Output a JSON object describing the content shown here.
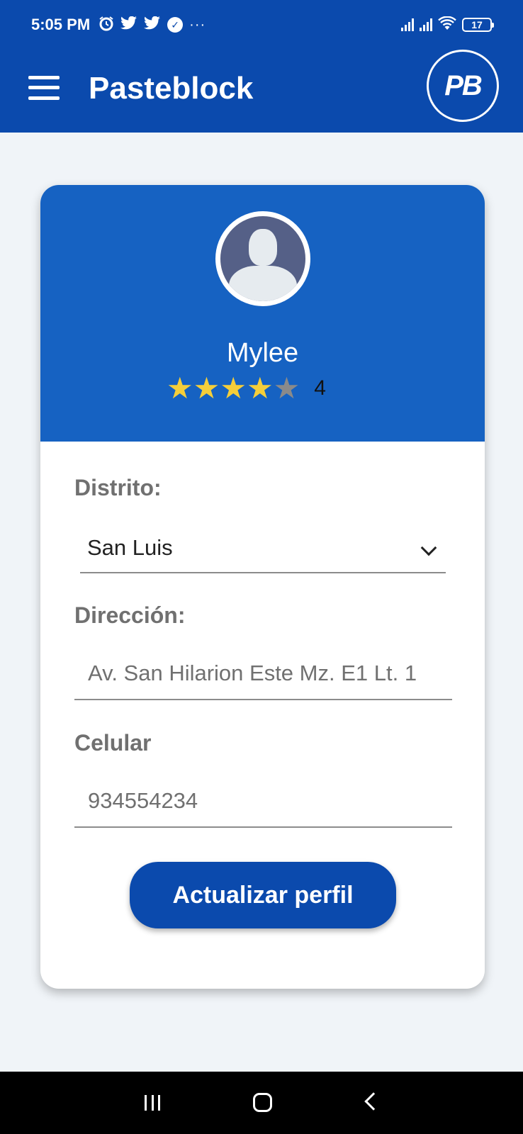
{
  "status_bar": {
    "time": "5:05 PM",
    "battery": "17",
    "left_icons": [
      "alarm-icon",
      "twitter-icon",
      "twitter-icon",
      "check-circle-icon",
      "more-icon"
    ],
    "right_icons": [
      "signal-icon",
      "signal-icon",
      "wifi-icon",
      "battery-icon"
    ]
  },
  "app_bar": {
    "title": "Pasteblock",
    "logo_text": "PB",
    "menu_icon": "hamburger-menu-icon"
  },
  "profile": {
    "name": "Mylee",
    "rating": 4,
    "rating_max": 5,
    "rating_label": "4"
  },
  "form": {
    "district_label": "Distrito:",
    "district_value": "San Luis",
    "address_label": "Dirección:",
    "address_value": "Av. San Hilarion Este Mz. E1 Lt. 1",
    "phone_label": "Celular",
    "phone_value": "934554234",
    "submit_label": "Actualizar perfil"
  },
  "colors": {
    "primary": "#0b4aad",
    "header": "#1662c2",
    "star_on": "#f5ce3a",
    "star_off": "#8a8a8a"
  }
}
